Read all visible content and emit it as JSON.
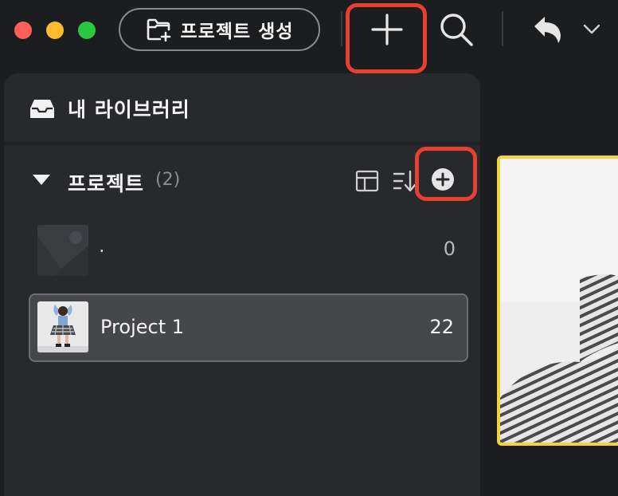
{
  "toolbar": {
    "create_project_label": "프로젝트 생성",
    "add_icon": "plus-icon",
    "search_icon": "search-icon",
    "undo_icon": "undo-icon",
    "dropdown_icon": "chevron-down-icon"
  },
  "sidebar": {
    "library_title": "내 라이브러리",
    "projects": {
      "title": "프로젝트",
      "count": "(2)",
      "items": [
        {
          "name": ".",
          "count": "0",
          "thumbnail": "placeholder-image"
        },
        {
          "name": "Project 1",
          "count": "22",
          "thumbnail": "photo-person",
          "selected": true
        }
      ]
    }
  },
  "colors": {
    "background": "#1c1d1f",
    "sidebar": "#28292c",
    "selected_item": "#46474b",
    "highlight": "#e8402f",
    "preview_border": "#f3d23c"
  }
}
